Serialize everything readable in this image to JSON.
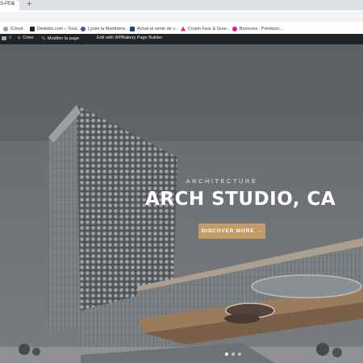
{
  "browser": {
    "active_tab_label": "S-PEC",
    "tab_close": "×",
    "new_tab": "+"
  },
  "bookmarks": [
    {
      "label": "iCloud",
      "color": "#9aa0a6"
    },
    {
      "label": "Dealabs.com – Tous...",
      "color": "#222222"
    },
    {
      "label": "Lycée la Martinière...",
      "color": "#5b4b9b"
    },
    {
      "label": "Achat et vente de v...",
      "color": "#1a3d8f"
    },
    {
      "label": "Crypto Fear & Gree...",
      "color": "#e53935"
    },
    {
      "label": "Boxicons : Premium...",
      "color": "#d81b9c"
    }
  ],
  "adminbar": {
    "comments_count": "0",
    "new_label": "Créer",
    "edit_label": "Modifier la page",
    "builder_label": "Edit with WPBakery Page Builder"
  },
  "hero": {
    "kicker": "ARCHITECTURE",
    "title": "ARCH STUDIO, CA",
    "cta": "DISCOVER MORE →",
    "accent": "#c49a69",
    "slides": 3,
    "active_slide": 1
  }
}
